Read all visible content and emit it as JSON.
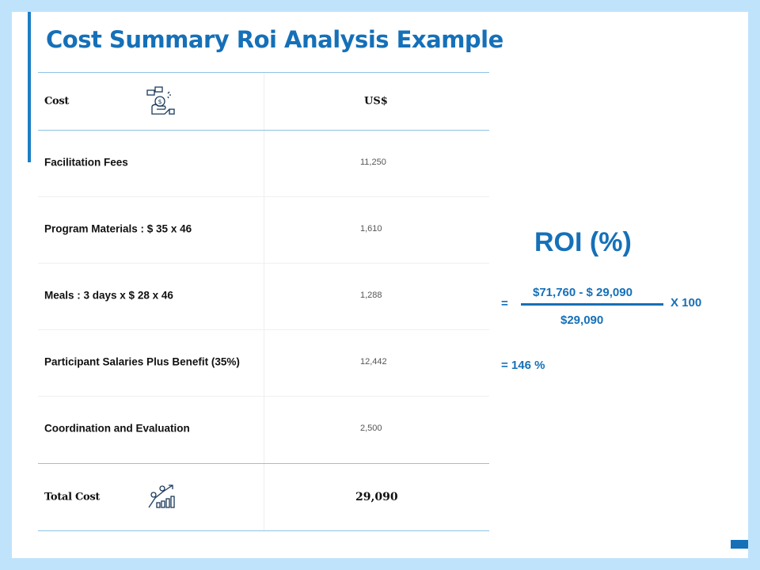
{
  "title": "Cost Summary Roi Analysis Example",
  "table": {
    "header": {
      "cost": "Cost",
      "currency": "US$"
    },
    "rows": [
      {
        "label": "Facilitation Fees",
        "value": "11,250"
      },
      {
        "label": "Program Materials : $ 35 x 46",
        "value": "1,610"
      },
      {
        "label": "Meals : 3 days x $ 28 x 46",
        "value": "1,288"
      },
      {
        "label": "Participant Salaries Plus Benefit (35%)",
        "value": "12,442"
      },
      {
        "label": "Coordination and Evaluation",
        "value": "2,500"
      }
    ],
    "total": {
      "label": "Total Cost",
      "value": "29,090"
    }
  },
  "roi": {
    "title": "ROI (%)",
    "equals": "=",
    "numerator": "$71,760 - $ 29,090",
    "denominator": "$29,090",
    "multiplier": "X 100",
    "result": "= 146 %"
  },
  "icons": {
    "header_icon": "money-hand-icon",
    "total_icon": "growth-chart-icon"
  },
  "colors": {
    "accent": "#1570b8",
    "background": "#bfe3fa"
  }
}
